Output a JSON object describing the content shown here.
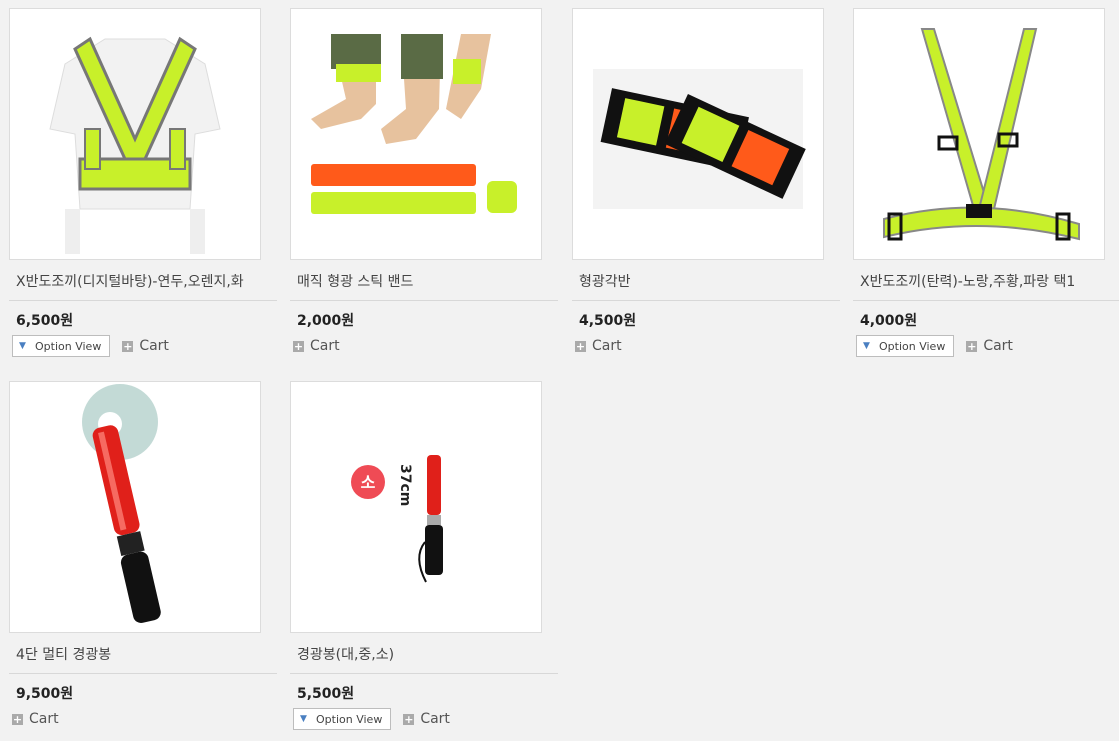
{
  "products": [
    {
      "name": "X반도조끼(디지털바탕)-연두,오렌지,화",
      "price": "6,500원",
      "option_view": "Option View",
      "cart": "Cart",
      "image_icon": "vest-icon"
    },
    {
      "name": "매직 형광 스틱 밴드",
      "price": "2,000원",
      "option_view": "",
      "cart": "Cart",
      "image_icon": "band-icon"
    },
    {
      "name": "형광각반",
      "price": "4,500원",
      "option_view": "",
      "cart": "Cart",
      "image_icon": "armband-icon"
    },
    {
      "name": "X반도조끼(탄력)-노랑,주황,파랑 택1",
      "price": "4,000원",
      "option_view": "Option View",
      "cart": "Cart",
      "image_icon": "harness-icon"
    },
    {
      "name": "4단 멀티 경광봉",
      "price": "9,500원",
      "option_view": "",
      "cart": "Cart",
      "image_icon": "baton-icon"
    },
    {
      "name": "경광봉(대,중,소)",
      "price": "5,500원",
      "option_view": "Option View",
      "cart": "Cart",
      "image_icon": "baton-small-icon",
      "badge": "소",
      "size_label": "37cm"
    }
  ],
  "colors": {
    "fluorescent": "#c8f02a",
    "orange": "#ff5a1a",
    "red_baton": "#e0201a",
    "badge": "#ef4b55"
  }
}
